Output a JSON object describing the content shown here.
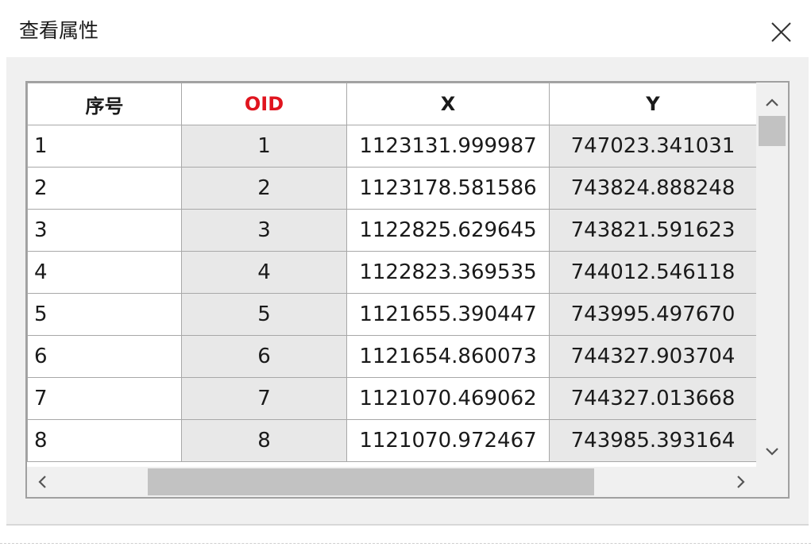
{
  "window": {
    "title": "查看属性"
  },
  "table": {
    "columns": [
      "序号",
      "OID",
      "X",
      "Y"
    ],
    "rows": [
      {
        "seq": "1",
        "oid": "1",
        "x": "1123131.999987",
        "y": "747023.341031"
      },
      {
        "seq": "2",
        "oid": "2",
        "x": "1123178.581586",
        "y": "743824.888248"
      },
      {
        "seq": "3",
        "oid": "3",
        "x": "1122825.629645",
        "y": "743821.591623"
      },
      {
        "seq": "4",
        "oid": "4",
        "x": "1122823.369535",
        "y": "744012.546118"
      },
      {
        "seq": "5",
        "oid": "5",
        "x": "1121655.390447",
        "y": "743995.497670"
      },
      {
        "seq": "6",
        "oid": "6",
        "x": "1121654.860073",
        "y": "744327.903704"
      },
      {
        "seq": "7",
        "oid": "7",
        "x": "1121070.469062",
        "y": "744327.013668"
      },
      {
        "seq": "8",
        "oid": "8",
        "x": "1121070.972467",
        "y": "743985.393164"
      }
    ]
  },
  "colors": {
    "oid_header": "#e0141e",
    "background": "#f0f0f0",
    "alt_column": "#e8e8e8"
  },
  "icons": {
    "close": "close-icon",
    "scroll_up": "chevron-up-icon",
    "scroll_down": "chevron-down-icon",
    "scroll_left": "chevron-left-icon",
    "scroll_right": "chevron-right-icon"
  }
}
